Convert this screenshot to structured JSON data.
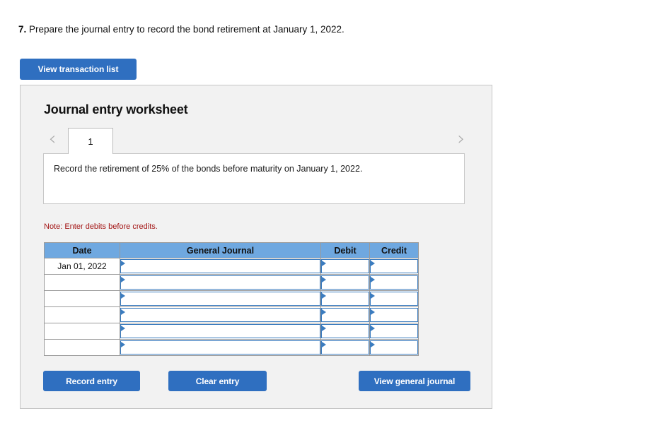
{
  "question": {
    "number": "7.",
    "text": "Prepare the journal entry to record the bond retirement at January 1, 2022."
  },
  "toolbar": {
    "view_transaction_list_label": "View transaction list"
  },
  "worksheet": {
    "title": "Journal entry worksheet",
    "prev_arrow": "‹",
    "next_arrow": "›",
    "tabs": [
      {
        "label": "1",
        "active": true
      }
    ],
    "instruction": "Record the retirement of 25% of the bonds before maturity on January 1, 2022.",
    "note": "Note: Enter debits before credits."
  },
  "table": {
    "headers": [
      "Date",
      "General Journal",
      "Debit",
      "Credit"
    ],
    "rows": [
      {
        "date": "Jan 01, 2022",
        "general_journal": "",
        "debit": "",
        "credit": ""
      },
      {
        "date": "",
        "general_journal": "",
        "debit": "",
        "credit": ""
      },
      {
        "date": "",
        "general_journal": "",
        "debit": "",
        "credit": ""
      },
      {
        "date": "",
        "general_journal": "",
        "debit": "",
        "credit": ""
      },
      {
        "date": "",
        "general_journal": "",
        "debit": "",
        "credit": ""
      },
      {
        "date": "",
        "general_journal": "",
        "debit": "",
        "credit": ""
      }
    ]
  },
  "actions": {
    "record_entry_label": "Record entry",
    "clear_entry_label": "Clear entry",
    "view_general_journal_label": "View general journal"
  },
  "colors": {
    "button_blue": "#2f6fc0",
    "table_header_blue": "#6fa8e0",
    "input_border_blue": "#3b7cbf",
    "panel_bg": "#f2f2f2",
    "note_red": "#a31515"
  }
}
